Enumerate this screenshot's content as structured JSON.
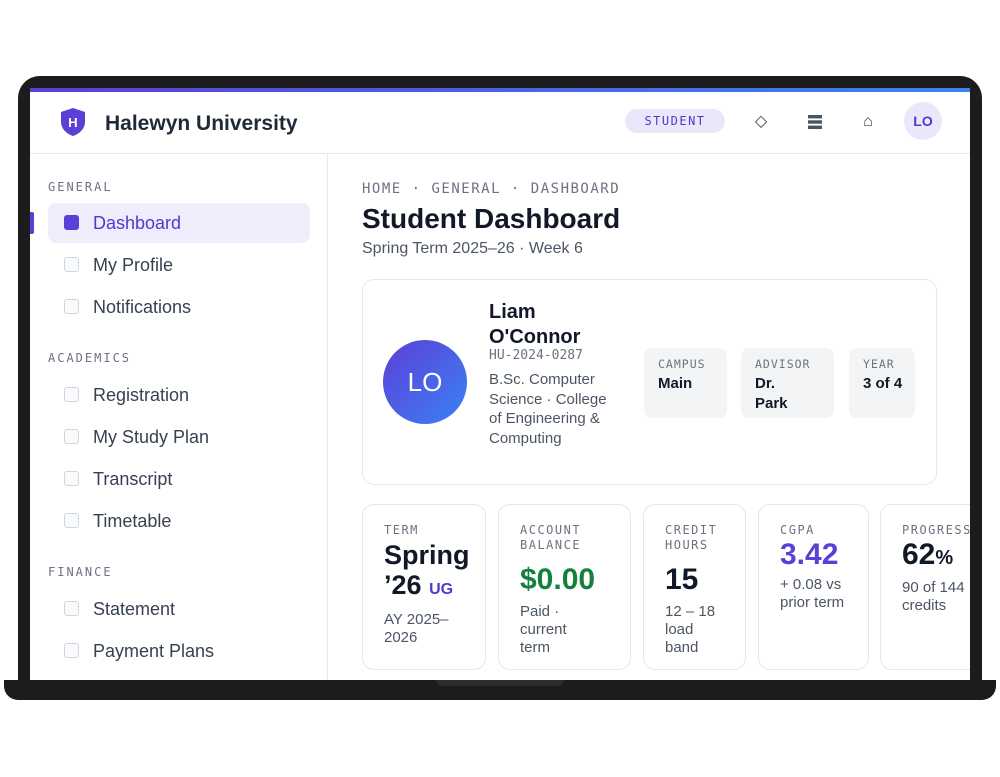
{
  "app": {
    "brand": "Halewyn University",
    "logo_letter": "H",
    "role_badge": "STUDENT",
    "user_initials": "LO",
    "colors": {
      "accent": "#5b3fd6",
      "accent_soft": "#efecfb",
      "positive": "#15803d"
    },
    "icons": [
      "diamond-icon",
      "stack-icon",
      "home-icon"
    ]
  },
  "sidebar": {
    "sections": [
      {
        "title": "GENERAL",
        "items": [
          {
            "label": "Dashboard",
            "active": true
          },
          {
            "label": "My Profile"
          },
          {
            "label": "Notifications"
          }
        ]
      },
      {
        "title": "ACADEMICS",
        "items": [
          {
            "label": "Registration"
          },
          {
            "label": "My Study Plan"
          },
          {
            "label": "Transcript"
          },
          {
            "label": "Timetable"
          }
        ]
      },
      {
        "title": "FINANCE",
        "items": [
          {
            "label": "Statement"
          },
          {
            "label": "Payment Plans"
          }
        ]
      }
    ]
  },
  "main": {
    "breadcrumb": "HOME · GENERAL · DASHBOARD",
    "title": "Student Dashboard",
    "subtitle": "Spring Term 2025–26 · Week 6",
    "profile": {
      "initials": "LO",
      "name": "Liam O'Connor",
      "student_id": "HU-2024-0287",
      "program": "B.Sc. Computer Science · College of Engineering & Computing",
      "chips": [
        {
          "label": "CAMPUS",
          "value": "Main"
        },
        {
          "label": "ADVISOR",
          "value": "Dr. Park"
        },
        {
          "label": "YEAR",
          "value": "3 of 4"
        }
      ]
    },
    "stats": [
      {
        "label": "TERM",
        "value": "Spring ’26",
        "unit": "UG",
        "note": "AY 2025–2026"
      },
      {
        "label": "ACCOUNT BALANCE",
        "value": "$0.00",
        "note": "Paid · current term"
      },
      {
        "label": "CREDIT HOURS",
        "value": "15",
        "note": "12 – 18 load band"
      },
      {
        "label": "CGPA",
        "value": "3.42",
        "note": "+ 0.08 vs prior term"
      },
      {
        "label": "PROGRESS",
        "value": "62",
        "suffix": "%",
        "note": "90 of 144 credits"
      }
    ]
  }
}
